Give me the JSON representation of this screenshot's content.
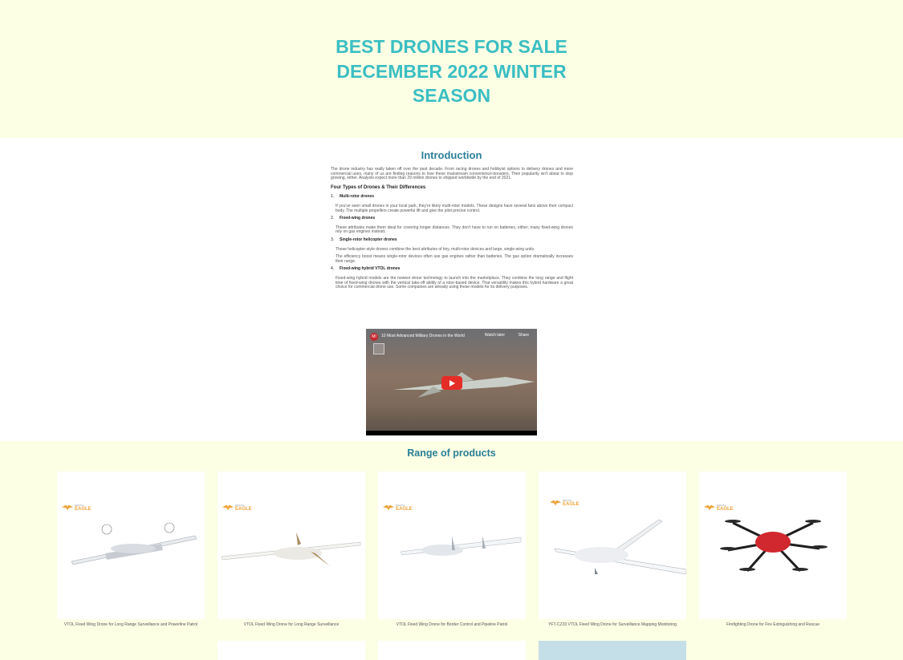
{
  "hero": {
    "title": "BEST DRONES FOR SALE DECEMBER 2022 WINTER SEASON"
  },
  "intro": {
    "heading": "Introduction",
    "paragraph": "The drone industry has really taken off over the past decade. From racing drones and hobbyist options to delivery drones and more commercial uses, many of us are finding reasons to love these mainstream convenience-boosters. Their popularity isn't about to stop growing, either. Analysts expect more than 29 million drones to shipped worldwide by the end of 2021.",
    "subheading": "Four Types of Drones & Their Differences",
    "types": [
      {
        "num": "1.",
        "title": "Multi-rotor drones",
        "texts": [
          "If you've seen small drones in your local park, they're likely multi-rotor models. These designs have several fans above their compact body. The multiple propellers create powerful lift and give the pilot precise control."
        ]
      },
      {
        "num": "2.",
        "title": "Fixed-wing drones",
        "texts": [
          "These attributes make them ideal for covering longer distances. They don't have to run on batteries, either; many fixed-wing drones rely on gas engines instead."
        ]
      },
      {
        "num": "3.",
        "title": "Single-rotor helicopter drones",
        "texts": [
          "These helicopter-style drones combine the best attributes of tiny, multi-rotor devices and large, single-wing units.",
          "The efficiency boost means single-rotor devices often use gas engines rather than batteries. The gas option dramatically increases their range."
        ]
      },
      {
        "num": "4.",
        "title": "Fixed-wing hybrid VTOL drones",
        "texts": [
          "Fixed-wing hybrid models are the newest drone technology to launch into the marketplace. They combine the long range and flight time of fixed-wing drones with the vertical take-off ability of a rotor-based device. That versatility makes this hybrid hardware a great choice for commercial drone use. Some companies are already using these models for its delivery purposes."
        ]
      }
    ],
    "video": {
      "title": "10 Most Advanced Military Drones in the World",
      "channel_badge": "MI",
      "watch_later": "Watch later",
      "share": "Share"
    }
  },
  "products": {
    "heading": "Range of products",
    "logo": {
      "top": "DIGITAL",
      "name": "EAGLE"
    },
    "items": [
      {
        "caption": "VTOL Fixed Wing Drone for Long Range Surveillance and Powerline Patrol"
      },
      {
        "caption": "VTOL Fixed Wing Drone for Long Range Surveillance"
      },
      {
        "caption": "VTOL Fixed Wing Drone for Border Control and Pipeline Patrol"
      },
      {
        "caption": "YFT-CZ33 VTOL Fixed Wing Drone for Surveillance Mapping Monitoring"
      },
      {
        "caption": "Firefighting Drone for Fire Extinguishing and Rescue"
      }
    ]
  },
  "colors": {
    "hero_bg": "#fdffe5",
    "title": "#3bbec2",
    "heading": "#2a7f96",
    "logo": "#f0a33a",
    "drone_red": "#d0282e"
  }
}
